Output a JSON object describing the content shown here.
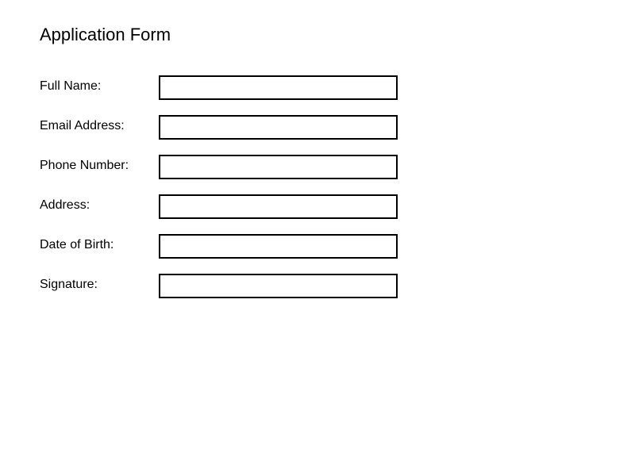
{
  "form": {
    "title": "Application Form",
    "fields": [
      {
        "label": "Full Name:",
        "value": ""
      },
      {
        "label": "Email Address:",
        "value": ""
      },
      {
        "label": "Phone Number:",
        "value": ""
      },
      {
        "label": "Address:",
        "value": ""
      },
      {
        "label": "Date of Birth:",
        "value": ""
      },
      {
        "label": "Signature:",
        "value": ""
      }
    ]
  },
  "colors": {
    "text": "#000000",
    "border": "#000000",
    "background": "#ffffff"
  }
}
